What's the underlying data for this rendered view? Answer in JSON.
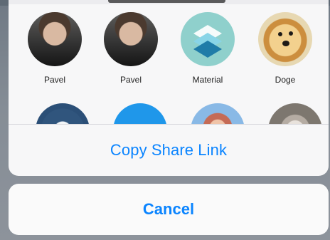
{
  "contacts": [
    {
      "name": "Pavel",
      "avatar": "person-avatar"
    },
    {
      "name": "Pavel",
      "avatar": "person-avatar"
    },
    {
      "name": "Material",
      "avatar": "stack-layers-icon"
    },
    {
      "name": "Doge",
      "avatar": "dog-avatar"
    }
  ],
  "actions": {
    "copy_share_link": "Copy Share Link",
    "cancel": "Cancel"
  },
  "colors": {
    "accent": "#0a84ff",
    "sheet": "#f7f7f8",
    "backdrop": "#858d96"
  }
}
